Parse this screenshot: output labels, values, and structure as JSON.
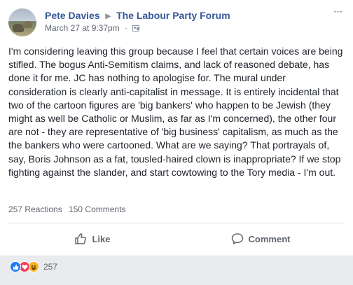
{
  "post": {
    "author": "Pete Davies",
    "group": "The Labour Party Forum",
    "timestamp": "March 27 at 9:37pm",
    "separator": "·",
    "more_menu": "···",
    "body": "I'm considering leaving this group because I feel that certain voices are being stifled. The bogus Anti-Semitism claims, and lack of reasoned debate, has done it for me. JC has nothing to apologise for. The mural under consideration is clearly anti-capitalist in message. It is entirely incidental that two of the cartoon figures are 'big bankers' who happen to be Jewish (they might as well be Catholic or Muslim, as far as I'm concerned), the other four are not - they are representative of 'big business' capitalism, as much as the the bankers who were cartooned. What are we saying? That portrayals of, say, Boris Johnson as a fat, tousled-haired clown is inappropriate? If we stop fighting against the slander, and start cowtowing to the Tory media - I'm out."
  },
  "stats": {
    "reactions": "257 Reactions",
    "comments": "150 Comments"
  },
  "actions": {
    "like": "Like",
    "comment": "Comment"
  },
  "reactions_bar": {
    "icons": [
      "like-icon",
      "love-icon",
      "haha-icon"
    ],
    "count": "257"
  },
  "colors": {
    "link": "#365899",
    "like": "#2078f4",
    "love": "#f33e58",
    "haha": "#f7b125"
  }
}
